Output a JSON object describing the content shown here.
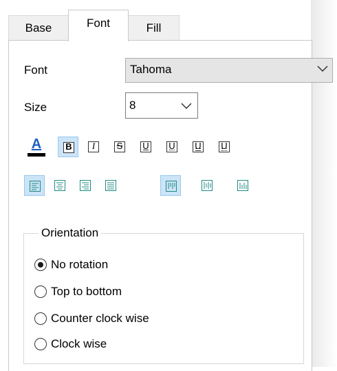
{
  "tabs": [
    {
      "label": "Base",
      "active": false
    },
    {
      "label": "Font",
      "active": true
    },
    {
      "label": "Fill",
      "active": false
    }
  ],
  "font": {
    "label": "Font",
    "value": "Tahoma"
  },
  "size": {
    "label": "Size",
    "value": "8"
  },
  "format_buttons": [
    {
      "name": "font-color",
      "glyph": "A",
      "color": "#1f5fbf"
    },
    {
      "name": "bold",
      "glyph": "B",
      "selected": true
    },
    {
      "name": "italic",
      "glyph": "I"
    },
    {
      "name": "strikethrough",
      "glyph": "S"
    },
    {
      "name": "underline",
      "glyph": "U"
    },
    {
      "name": "underline-dotted",
      "glyph": "U"
    },
    {
      "name": "underline-double",
      "glyph": "U"
    },
    {
      "name": "underline-wavy",
      "glyph": "U"
    }
  ],
  "alignment": {
    "horizontal": [
      "left",
      "center",
      "right",
      "justify"
    ],
    "horizontal_selected": "left",
    "vertical": [
      "top",
      "middle",
      "bottom"
    ],
    "vertical_selected": "top"
  },
  "orientation": {
    "legend": "Orientation",
    "options": [
      {
        "label": "No rotation",
        "checked": true
      },
      {
        "label": "Top to bottom",
        "checked": false
      },
      {
        "label": "Counter clock wise",
        "checked": false
      },
      {
        "label": "Clock wise",
        "checked": false
      }
    ]
  },
  "colors": {
    "selected_bg": "#cce4f7",
    "selected_border": "#99c9ef",
    "accent_blue": "#1f5fbf",
    "icon_teal": "#1f8a80"
  }
}
